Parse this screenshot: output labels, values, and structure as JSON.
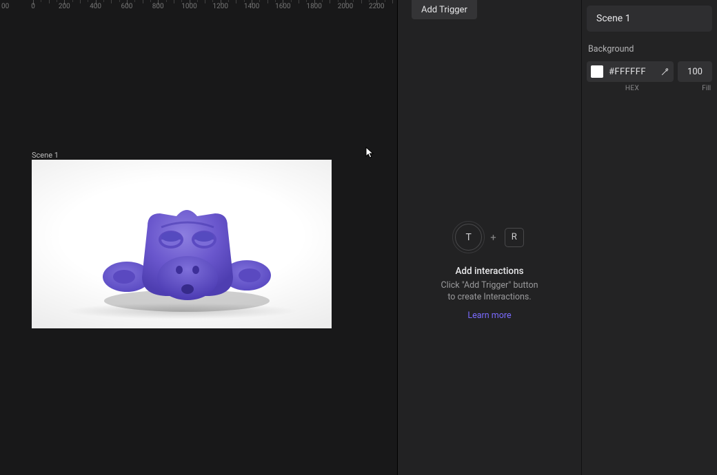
{
  "canvas": {
    "ruler_ticks": [
      0,
      200,
      400,
      600,
      800,
      1000,
      1200,
      1400,
      1600,
      1800,
      2000,
      2200
    ],
    "scene_label": "Scene 1"
  },
  "mid": {
    "add_trigger_label": "Add Trigger",
    "circle_letter": "T",
    "plus_symbol": "+",
    "square_letter": "R",
    "title": "Add interactions",
    "sub_line1": "Click \"Add Trigger\" button",
    "sub_line2": "to create Interactions.",
    "learn_more": "Learn more"
  },
  "inspector": {
    "header_title": "Scene 1",
    "background_label": "Background",
    "hex_value": "#FFFFFF",
    "fill_value": "100",
    "hex_sub": "HEX",
    "fill_sub": "Fill"
  }
}
